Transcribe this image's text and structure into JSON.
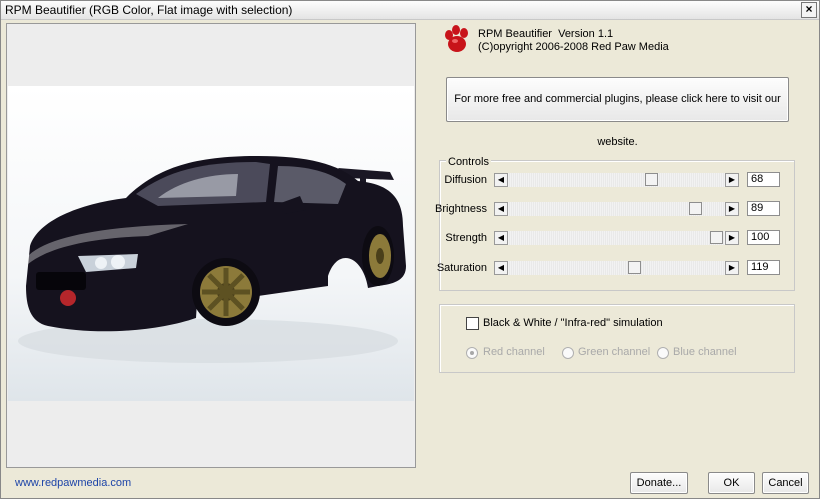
{
  "window": {
    "title": "RPM Beautifier (RGB Color, Flat image with selection)",
    "close_symbol": "×"
  },
  "app": {
    "name_line": "RPM Beautifier  Version 1.1",
    "copyright_line": "(C)opyright 2006-2008 Red Paw Media"
  },
  "website_button": "For more free and commercial plugins, please click here to visit our website.",
  "controls": {
    "group_label": "Controls",
    "items": [
      {
        "label": "Diffusion",
        "value": "68"
      },
      {
        "label": "Brightness",
        "value": "89"
      },
      {
        "label": "Strength",
        "value": "100"
      },
      {
        "label": "Saturation",
        "value": "119"
      }
    ],
    "left_arrow": "◀",
    "right_arrow": "▶"
  },
  "bw": {
    "checkbox_label": "Black & White / \"Infra-red\" simulation",
    "checked": false,
    "radios": [
      {
        "label": "Red channel",
        "selected": true
      },
      {
        "label": "Green channel",
        "selected": false
      },
      {
        "label": "Blue channel",
        "selected": false
      }
    ]
  },
  "footer": {
    "link": "www.redpawmedia.com"
  },
  "buttons": {
    "donate": "Donate...",
    "ok": "OK",
    "cancel": "Cancel"
  },
  "colors": {
    "logo_red": "#c8141a",
    "car_body": "#15121e",
    "wheel_gold": "#8c7a3a",
    "link_blue": "#1d44a8"
  }
}
